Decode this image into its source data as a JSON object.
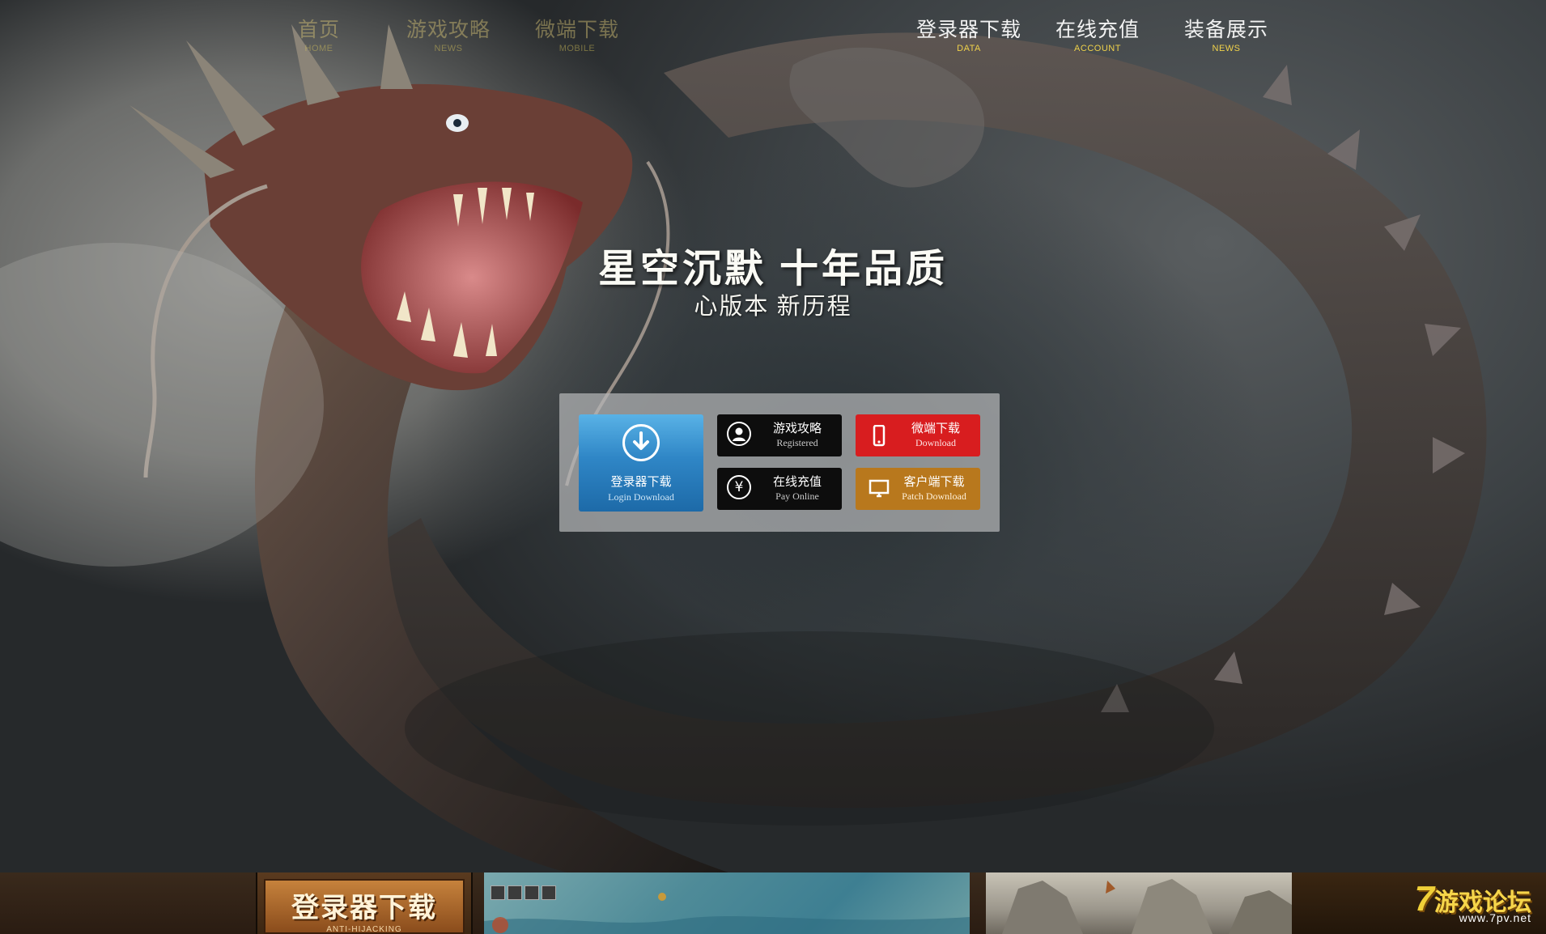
{
  "nav": {
    "left": [
      {
        "cn": "首页",
        "en": "HOME"
      },
      {
        "cn": "游戏攻略",
        "en": "NEWS"
      },
      {
        "cn": "微端下载",
        "en": "MOBILE"
      }
    ],
    "right": [
      {
        "cn": "登录器下载",
        "en": "DATA"
      },
      {
        "cn": "在线充值",
        "en": "ACCOUNT"
      },
      {
        "cn": "装备展示",
        "en": "NEWS"
      }
    ]
  },
  "slogan": {
    "main": "星空沉默 十年品质",
    "sub": "心版本 新历程"
  },
  "panel": {
    "login_download": {
      "cn": "登录器下载",
      "en": "Login Download"
    },
    "guide": {
      "cn": "游戏攻略",
      "en": "Registered"
    },
    "mobile": {
      "cn": "微端下载",
      "en": "Download"
    },
    "pay": {
      "cn": "在线充值",
      "en": "Pay Online"
    },
    "client": {
      "cn": "客户端下载",
      "en": "Patch Download"
    },
    "icons": {
      "login_download": "download-arrow-icon",
      "guide": "user-icon",
      "mobile": "phone-icon",
      "pay": "yen-icon",
      "client": "monitor-icon"
    },
    "colors": {
      "login_download": "#2f86c6",
      "guide": "#0d0d0d",
      "mobile": "#d81d1f",
      "pay": "#0d0d0d",
      "client": "#b8781d"
    }
  },
  "bottom": {
    "banner_title": "登录器下载",
    "banner_sub": "ANTI-HIJACKING",
    "logo_num": "7",
    "logo_text": "游戏论坛",
    "logo_url": "www.7pv.net"
  }
}
